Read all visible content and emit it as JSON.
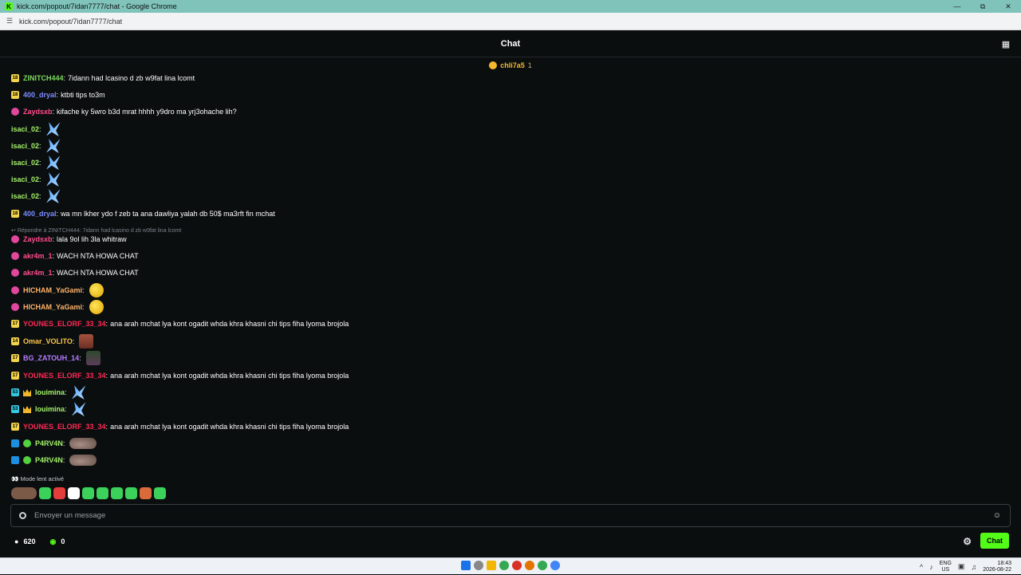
{
  "window": {
    "title": "kick.com/popout/7idan7777/chat - Google Chrome",
    "url": "kick.com/popout/7idan7777/chat",
    "logo_letter": "K"
  },
  "header": {
    "title": "Chat"
  },
  "pinned_gifter": {
    "name": "chli7a5",
    "count": "1"
  },
  "reply_reference": "Répondre à ZINITCH444: 7idann had lcasino d zb w9fat lina lcomt",
  "messages": [
    {
      "badges": [
        "sub-yellow"
      ],
      "badge_text": "18",
      "user": "ZINITCH444",
      "color": "#7dd95f",
      "text": "7idann had lcasino d zb w9fat lina lcomt",
      "emotes": []
    },
    {
      "badges": [
        "sub-yellow"
      ],
      "badge_text": "18",
      "user": "400_dryal",
      "color": "#7b8cff",
      "text": "ktbti tips to3m",
      "emotes": []
    },
    {
      "badges": [
        "sub-pink"
      ],
      "badge_text": "",
      "user": "Zaydsxb",
      "color": "#ff4d8d",
      "text": "kifache ky 5wro b3d mrat hhhh y9dro ma yrj3ohache lih?",
      "emotes": []
    },
    {
      "badges": [],
      "badge_text": "",
      "user": "isaci_02",
      "color": "#a2f06a",
      "text": "",
      "emotes": [
        "blue"
      ]
    },
    {
      "badges": [],
      "badge_text": "",
      "user": "isaci_02",
      "color": "#a2f06a",
      "text": "",
      "emotes": [
        "blue"
      ]
    },
    {
      "badges": [],
      "badge_text": "",
      "user": "isaci_02",
      "color": "#a2f06a",
      "text": "",
      "emotes": [
        "blue"
      ]
    },
    {
      "badges": [],
      "badge_text": "",
      "user": "isaci_02",
      "color": "#a2f06a",
      "text": "",
      "emotes": [
        "blue"
      ]
    },
    {
      "badges": [],
      "badge_text": "",
      "user": "isaci_02",
      "color": "#a2f06a",
      "text": "",
      "emotes": [
        "blue"
      ]
    },
    {
      "badges": [
        "sub-yellow"
      ],
      "badge_text": "18",
      "user": "400_dryal",
      "color": "#7b8cff",
      "text": "wa mn lkher ydo f zeb ta ana dawliya yalah db 50$ ma3rft fin mchat",
      "emotes": []
    },
    {
      "badges": [
        "sub-pink"
      ],
      "badge_text": "",
      "user": "Zaydsxb",
      "color": "#ff4d8d",
      "text": "lala 9ol lih 3la whitraw",
      "emotes": [],
      "reply": true
    },
    {
      "badges": [
        "sub-pink"
      ],
      "badge_text": "",
      "user": "akr4m_1",
      "color": "#ff4d8d",
      "text": "WACH NTA HOWA CHAT",
      "emotes": []
    },
    {
      "badges": [
        "sub-pink"
      ],
      "badge_text": "",
      "user": "akr4m_1",
      "color": "#ff4d8d",
      "text": "WACH NTA HOWA CHAT",
      "emotes": []
    },
    {
      "badges": [
        "sub-pink"
      ],
      "badge_text": "",
      "user": "HICHAM_YaGami",
      "color": "#ffb36b",
      "text": "",
      "emotes": [
        "yellow"
      ]
    },
    {
      "badges": [
        "sub-pink"
      ],
      "badge_text": "",
      "user": "HICHAM_YaGami",
      "color": "#ffb36b",
      "text": "",
      "emotes": [
        "yellow"
      ]
    },
    {
      "badges": [
        "sub-yellow"
      ],
      "badge_text": "17",
      "user": "YOUNES_ELORF_33_34",
      "color": "#ff2a55",
      "text": "ana arah mchat lya kont ogadit whda khra khasni chi tips fiha lyoma brojola",
      "emotes": []
    },
    {
      "badges": [
        "sub-yellow"
      ],
      "badge_text": "14",
      "user": "Omar_VOLITO",
      "color": "#ffc94d",
      "text": "",
      "emotes": [
        "face"
      ]
    },
    {
      "badges": [
        "sub-yellow"
      ],
      "badge_text": "17",
      "user": "BG_ZATOUH_14",
      "color": "#b47cff",
      "text": "",
      "emotes": [
        "dark"
      ]
    },
    {
      "badges": [
        "sub-yellow"
      ],
      "badge_text": "17",
      "user": "YOUNES_ELORF_33_34",
      "color": "#ff2a55",
      "text": "ana arah mchat lya kont ogadit whda khra khasni chi tips fiha lyoma brojola",
      "emotes": []
    },
    {
      "badges": [
        "sub-cyan",
        "crown"
      ],
      "badge_text": "53",
      "user": "louimina",
      "color": "#a2f06a",
      "text": "",
      "emotes": [
        "blue"
      ]
    },
    {
      "badges": [
        "sub-cyan",
        "crown"
      ],
      "badge_text": "53",
      "user": "louimina",
      "color": "#a2f06a",
      "text": "",
      "emotes": [
        "blue"
      ]
    },
    {
      "badges": [
        "sub-yellow"
      ],
      "badge_text": "17",
      "user": "YOUNES_ELORF_33_34",
      "color": "#ff2a55",
      "text": "ana arah mchat lya kont ogadit whda khra khasni chi tips fiha lyoma brojola",
      "emotes": []
    },
    {
      "badges": [
        "mod",
        "verified"
      ],
      "badge_text": "",
      "user": "P4RV4N",
      "color": "#a2f06a",
      "text": "",
      "emotes": [
        "pile"
      ]
    },
    {
      "badges": [
        "mod",
        "verified"
      ],
      "badge_text": "",
      "user": "P4RV4N",
      "color": "#a2f06a",
      "text": "",
      "emotes": [
        "pile"
      ]
    }
  ],
  "slow_mode": "Mode lent activé",
  "emote_bar_colors": [
    "#7b5a48",
    "#3bd15a",
    "#e23c3c",
    "#ffffff",
    "#3bd15a",
    "#3bd15a",
    "#3bd15a",
    "#3bd15a",
    "#d96a3a",
    "#3bd15a"
  ],
  "input": {
    "placeholder": "Envoyer un message",
    "value": ""
  },
  "footer": {
    "viewers": "620",
    "points": "0",
    "send_label": "Chat"
  },
  "taskbar": {
    "lang_top": "ENG",
    "lang_bottom": "US",
    "time": "18:43",
    "date": "2026-08-22"
  },
  "colors": {
    "kick_green": "#53fc18",
    "background": "#0b0e0f",
    "titlebar": "#7fc3ba"
  }
}
